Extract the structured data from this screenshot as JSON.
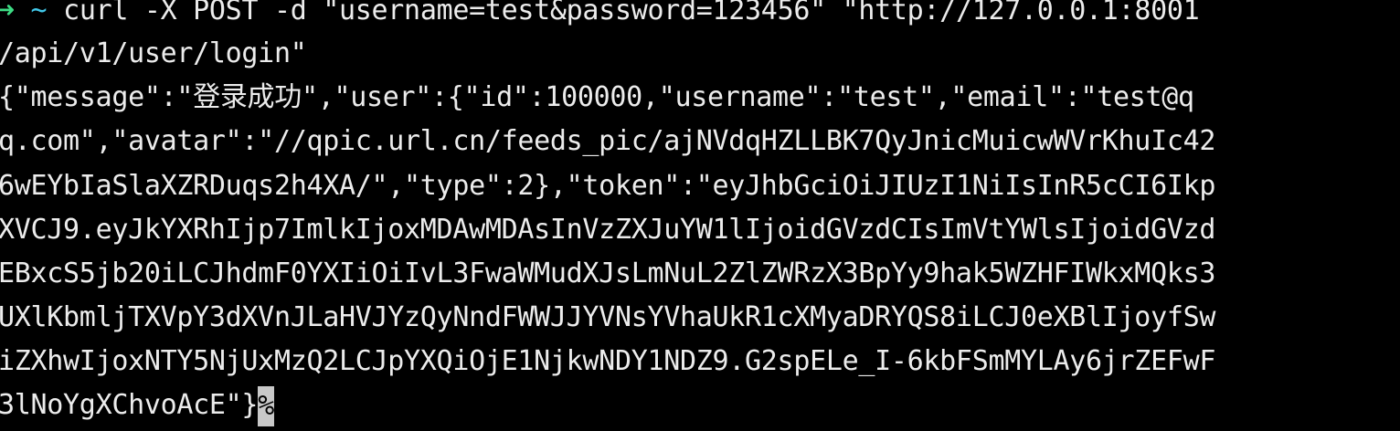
{
  "terminal": {
    "prompt_symbol": "➜",
    "prompt_dir": "~",
    "command": "curl -X POST -d \"username=test&password=123456\" \"http://127.0.0.1:8001",
    "output_lines": [
      "/api/v1/user/login\"",
      "{\"message\":\"登录成功\",\"user\":{\"id\":100000,\"username\":\"test\",\"email\":\"test@q",
      "q.com\",\"avatar\":\"//qpic.url.cn/feeds_pic/ajNVdqHZLLBK7QyJnicMuicwWVrKhuIc42",
      "6wEYbIaSlaXZRDuqs2h4XA/\",\"type\":2},\"token\":\"eyJhbGciOiJIUzI1NiIsInR5cCI6Ikp",
      "XVCJ9.eyJkYXRhIjp7ImlkIjoxMDAwMDAsInVzZXJuYW1lIjoidGVzdCIsImVtYWlsIjoidGVzd",
      "EBxcS5jb20iLCJhdmF0YXIiOiIvL3FwaWMudXJsLmNuL2ZlZWRzX3BpYy9hak5WZHFIWkxMQks3",
      "UXlKbmljTXVpY3dXVnJLaHVJYzQyNndFWWJJYVNsYVhaUkR1cXMyaDRYQS8iLCJ0eXBlIjoyfSw",
      "iZXhwIjoxNTY5NjUxMzQ2LCJpYXQiOjE1NjkwNDY1NDZ9.G2spELe_I-6kbFSmMYLAy6jrZEFwF"
    ],
    "last_line_text": "3lNoYgXChvoAcE\"}",
    "cursor_char": "%"
  },
  "colors": {
    "background": "#000000",
    "foreground": "#ececec",
    "prompt_arrow": "#3ddc84",
    "prompt_dir": "#41c7e8",
    "cursor": "#c8c8c8"
  }
}
